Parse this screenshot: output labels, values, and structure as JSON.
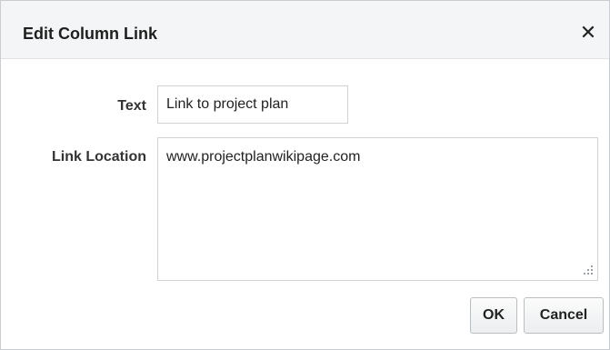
{
  "dialog": {
    "title": "Edit Column Link",
    "close_symbol": "✕"
  },
  "form": {
    "text_label": "Text",
    "text_value": "Link to project plan",
    "link_label": "Link Location",
    "link_value": "www.projectplanwikipage.com"
  },
  "buttons": {
    "ok_label": "OK",
    "cancel_label": "Cancel"
  },
  "icons": {
    "close": "close-icon",
    "resize": "resize-grip-icon"
  }
}
